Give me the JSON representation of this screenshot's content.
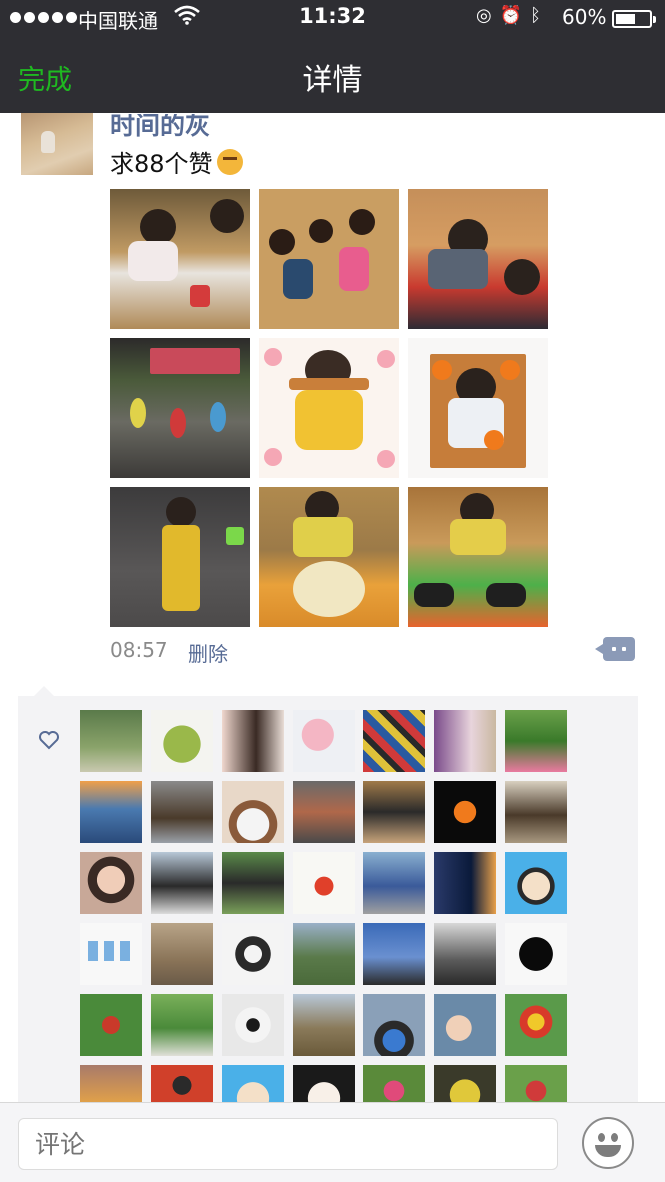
{
  "status_bar": {
    "carrier": "中国联通",
    "time": "11:32",
    "battery": "60%",
    "battery_level": 0.6
  },
  "nav": {
    "done_label": "完成",
    "title": "详情"
  },
  "post": {
    "username": "时间的灰",
    "content": "求88个赞",
    "time": "08:57",
    "delete_label": "删除",
    "photo_count": 9
  },
  "likes": {
    "icon": "heart-outline-icon",
    "avatar_count": 42
  },
  "comment_bar": {
    "placeholder": "评论",
    "emoji_icon": "smiley-face-icon"
  },
  "colors": {
    "accent_green": "#1fb921",
    "link_blue": "#576b95",
    "nav_bg": "#2e2e33"
  }
}
